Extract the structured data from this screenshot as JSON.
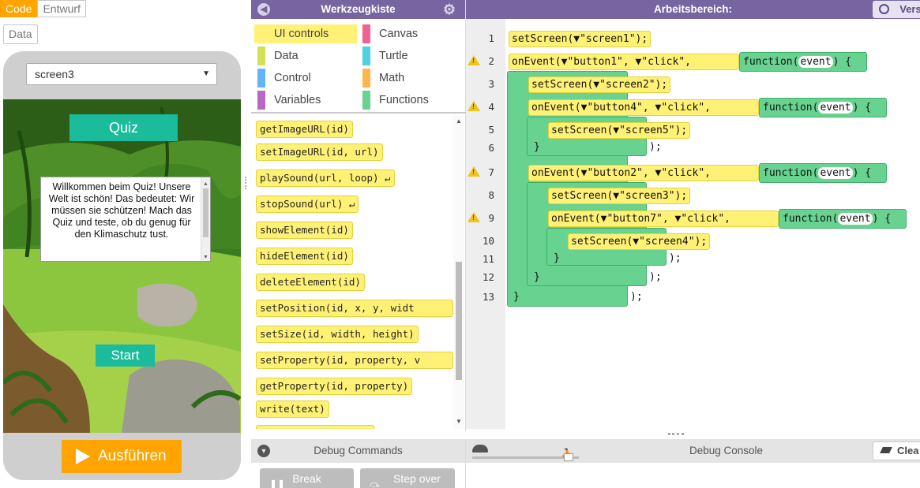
{
  "mode_toggle": {
    "code": "Code",
    "design": "Entwurf"
  },
  "data_button": "Data",
  "app": {
    "screen_selected": "screen3",
    "quiz_label": "Quiz",
    "welcome_text": "Willkommen beim Quiz! Unsere Welt ist schön! Das bedeutet: Wir müssen sie schützen! Mach das Quiz und teste, ob du genug für den Klimaschutz tust.",
    "start_button": "Start"
  },
  "run_button": "Ausführen",
  "toolbox": {
    "title": "Werkzeugkiste",
    "categories": [
      {
        "label": "UI controls",
        "color": "#fff176",
        "selected": true
      },
      {
        "label": "Canvas",
        "color": "#f06292"
      },
      {
        "label": "Data",
        "color": "#d4e157"
      },
      {
        "label": "Turtle",
        "color": "#4dd0e1"
      },
      {
        "label": "Control",
        "color": "#64b5f6"
      },
      {
        "label": "Math",
        "color": "#ffb74d"
      },
      {
        "label": "Variables",
        "color": "#ba68c8"
      },
      {
        "label": "Functions",
        "color": "#68d391"
      }
    ],
    "blocks": [
      "getImageURL(id)",
      "setImageURL(id, url)",
      "playSound(url, loop) ↵",
      "stopSound(url) ↵",
      "showElement(id)",
      "hideElement(id)",
      "deleteElement(id)",
      "setPosition(id, x, y, widt",
      "setSize(id, width, height)",
      "setProperty(id, property, v",
      "getProperty(id, property)",
      "write(text)"
    ]
  },
  "workspace": {
    "title": "Arbeitsbereich:",
    "version_button": "Vers",
    "line_numbers": [
      "1",
      "2",
      "3",
      "4",
      "5",
      "6",
      "7",
      "8",
      "9",
      "10",
      "11",
      "12",
      "13"
    ],
    "code": {
      "l1": "setScreen(▼\"screen1\");",
      "l2": "onEvent(▼\"button1\", ▼\"click\",",
      "l3": "setScreen(▼\"screen2\");",
      "l4": "onEvent(▼\"button4\", ▼\"click\",",
      "l5": "setScreen(▼\"screen5\");",
      "l7": "onEvent(▼\"button2\", ▼\"click\",",
      "l8": "setScreen(▼\"screen3\");",
      "l9": "onEvent(▼\"button7\", ▼\"click\",",
      "l10": "setScreen(▼\"screen4\");",
      "fn_word": "function",
      "fn_param": "event",
      "open_brace": "{",
      "close_brace": "}",
      "close_paren": ");"
    }
  },
  "debug_commands": {
    "title": "Debug Commands",
    "break": "Break",
    "step_over": "Step over"
  },
  "debug_console": {
    "title": "Debug Console",
    "clear": "Clea"
  }
}
